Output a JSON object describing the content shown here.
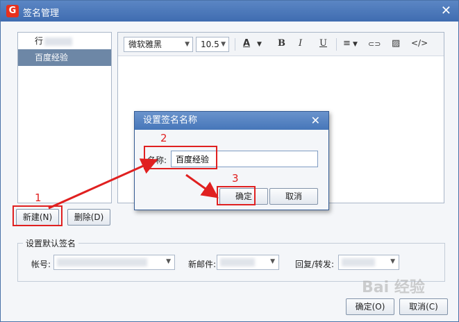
{
  "window": {
    "title": "签名管理",
    "logo": "G"
  },
  "signature_list": {
    "items": [
      {
        "label": "行"
      },
      {
        "label": "百度经验"
      }
    ]
  },
  "editor_toolbar": {
    "font_family": "微软雅黑",
    "font_size": "10.5",
    "font_color_label": "A",
    "bold_label": "B",
    "italic_label": "I",
    "underline_label": "U",
    "align_label": "≡",
    "link_label": "⊂⊃",
    "image_label": "▨",
    "code_label": "</>"
  },
  "buttons": {
    "new_label": "新建(N)",
    "delete_label": "删除(D)",
    "ok_label": "确定(O)",
    "cancel_label": "取消(C)"
  },
  "default_signature": {
    "title": "设置默认签名",
    "account_label": "帐号:",
    "new_mail_label": "新邮件:",
    "reply_forward_label": "回复/转发:"
  },
  "rename_dialog": {
    "title": "设置签名名称",
    "name_label": "名称:",
    "name_value": "百度经验",
    "ok_label": "确定",
    "cancel_label": "取消"
  },
  "annotations": {
    "step1": "1",
    "step2": "2",
    "step3": "3",
    "annotation_color": "#e02020"
  },
  "watermark": "Bai 经验"
}
